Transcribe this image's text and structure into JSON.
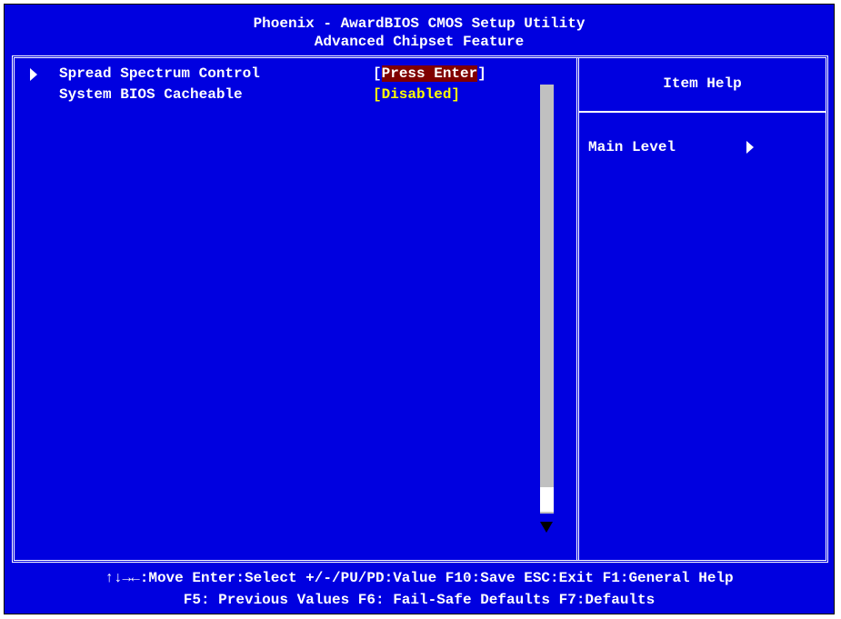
{
  "header": {
    "title": "Phoenix - AwardBIOS CMOS Setup Utility",
    "subtitle": "Advanced Chipset Feature"
  },
  "items": [
    {
      "label": "Spread Spectrum Control",
      "value": "Press Enter",
      "has_submenu": true,
      "selected": true
    },
    {
      "label": "System BIOS Cacheable",
      "value": "[Disabled]",
      "has_submenu": false,
      "selected": false
    }
  ],
  "brackets": {
    "open": "[",
    "close": "]"
  },
  "help": {
    "title": "Item Help",
    "text": "Main Level"
  },
  "footer": {
    "line1": "↑↓→←:Move  Enter:Select  +/-/PU/PD:Value  F10:Save  ESC:Exit  F1:General Help",
    "line2": "F5: Previous Values    F6: Fail-Safe Defaults    F7:Defaults"
  },
  "colors": {
    "background": "#0000e0",
    "selection": "#7f0000",
    "value": "#ffff00",
    "text": "#ffffff"
  },
  "icons": {
    "submenu_pointer": "triangle-right-icon",
    "help_arrow": "triangle-right-icon",
    "scroll_down": "triangle-down-icon"
  }
}
